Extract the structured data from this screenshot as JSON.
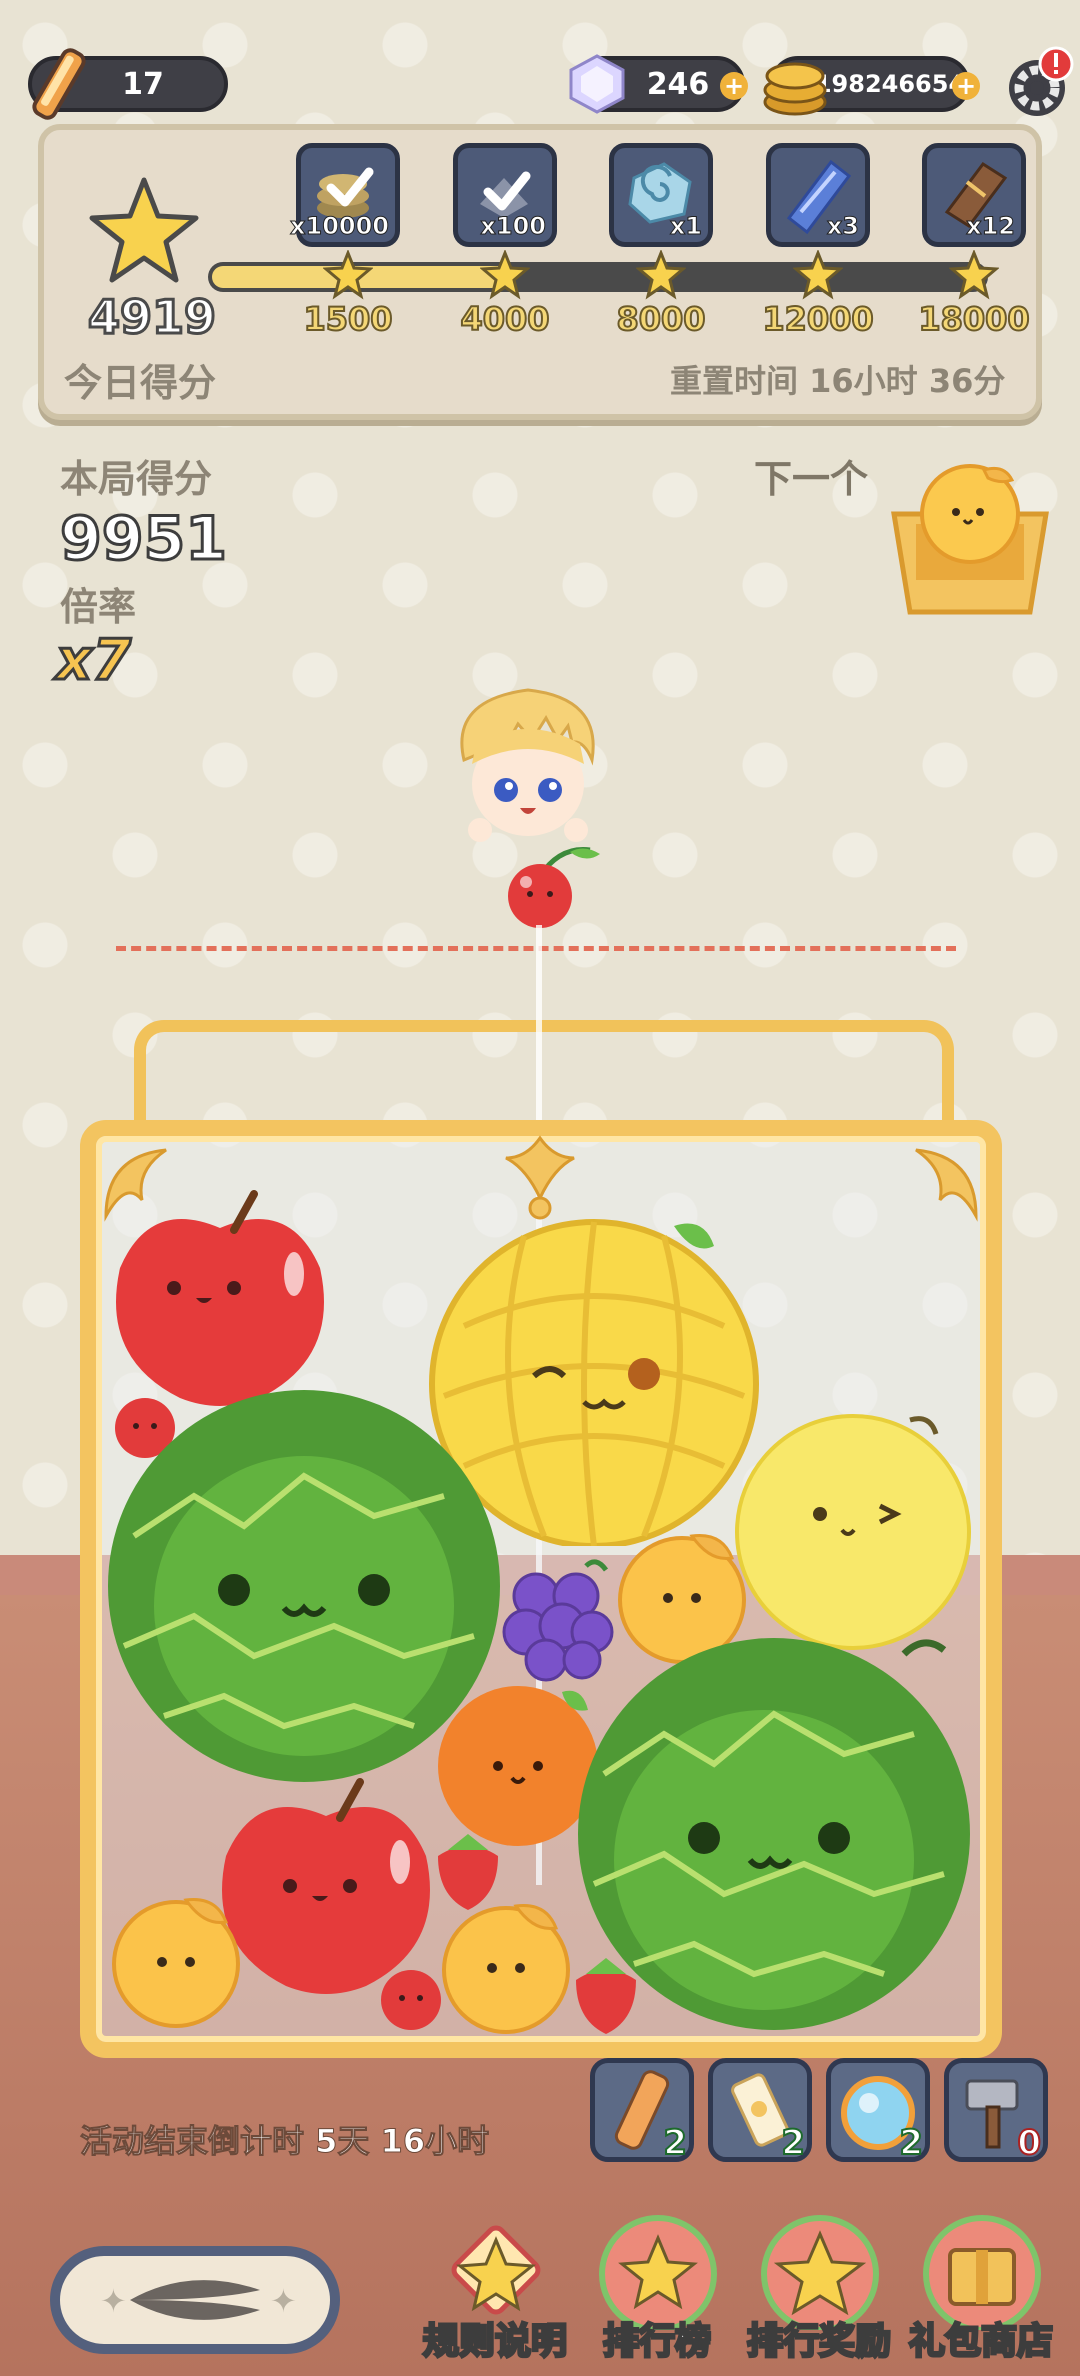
{
  "top_bar": {
    "energy": "17",
    "gems": "246",
    "coins": "198246654"
  },
  "daily": {
    "score": "4919",
    "label": "今日得分",
    "reset_text": "重置时间 16小时 36分",
    "progress_value": 4919,
    "progress_max": 18000,
    "milestones": [
      "1500",
      "4000",
      "8000",
      "12000",
      "18000"
    ],
    "rewards": [
      {
        "qty": "x10000",
        "icon": "coin-stack-icon",
        "claimed": true
      },
      {
        "qty": "x100",
        "icon": "gem-stack-icon",
        "claimed": true
      },
      {
        "qty": "x1",
        "icon": "spiral-stone-icon",
        "claimed": false
      },
      {
        "qty": "x3",
        "icon": "blue-ticket-icon",
        "claimed": false
      },
      {
        "qty": "x12",
        "icon": "wood-chest-icon",
        "claimed": false
      }
    ]
  },
  "round": {
    "score_label": "本局得分",
    "score": "9951",
    "multiplier_label": "倍率",
    "multiplier": "x7",
    "next_label": "下一个",
    "next_fruit": "orange-fruit"
  },
  "fruits": [
    "apple",
    "cherry",
    "watermelon",
    "pineapple-melon",
    "lemon",
    "grape",
    "orange",
    "tangerine",
    "strawberry",
    "melon"
  ],
  "tools": [
    {
      "icon": "bandage-icon",
      "count": "2"
    },
    {
      "icon": "potion-icon",
      "count": "2"
    },
    {
      "icon": "orb-icon",
      "count": "2"
    },
    {
      "icon": "hammer-icon",
      "count": "0"
    }
  ],
  "countdown": "活动结束倒计时 5天 16小时",
  "nav": [
    {
      "label": "规则说明"
    },
    {
      "label": "排行榜"
    },
    {
      "label": "排行奖励"
    },
    {
      "label": "礼包商店"
    }
  ],
  "colors": {
    "accent_gold": "#f3c460",
    "panel_dark": "#3f3f46",
    "text_gray": "#8d8576"
  }
}
